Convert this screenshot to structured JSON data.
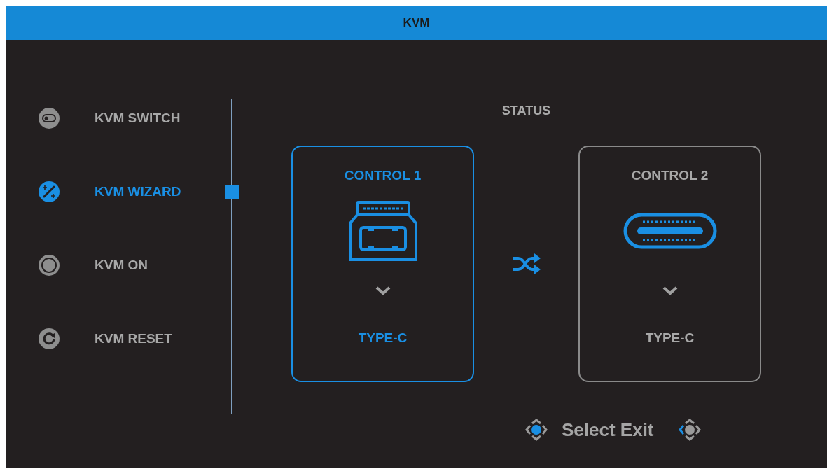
{
  "window": {
    "title": "KVM"
  },
  "menu": {
    "items": [
      {
        "label": "KVM SWITCH",
        "selected": false
      },
      {
        "label": "KVM WIZARD",
        "selected": true
      },
      {
        "label": "KVM ON",
        "selected": false
      },
      {
        "label": "KVM RESET",
        "selected": false
      }
    ]
  },
  "status": {
    "label": "STATUS",
    "controls": [
      {
        "title": "CONTROL 1",
        "port": "TYPE-C",
        "selected": true
      },
      {
        "title": "CONTROL 2",
        "port": "TYPE-C",
        "selected": false
      }
    ]
  },
  "footer": {
    "hint": "Select Exit"
  }
}
